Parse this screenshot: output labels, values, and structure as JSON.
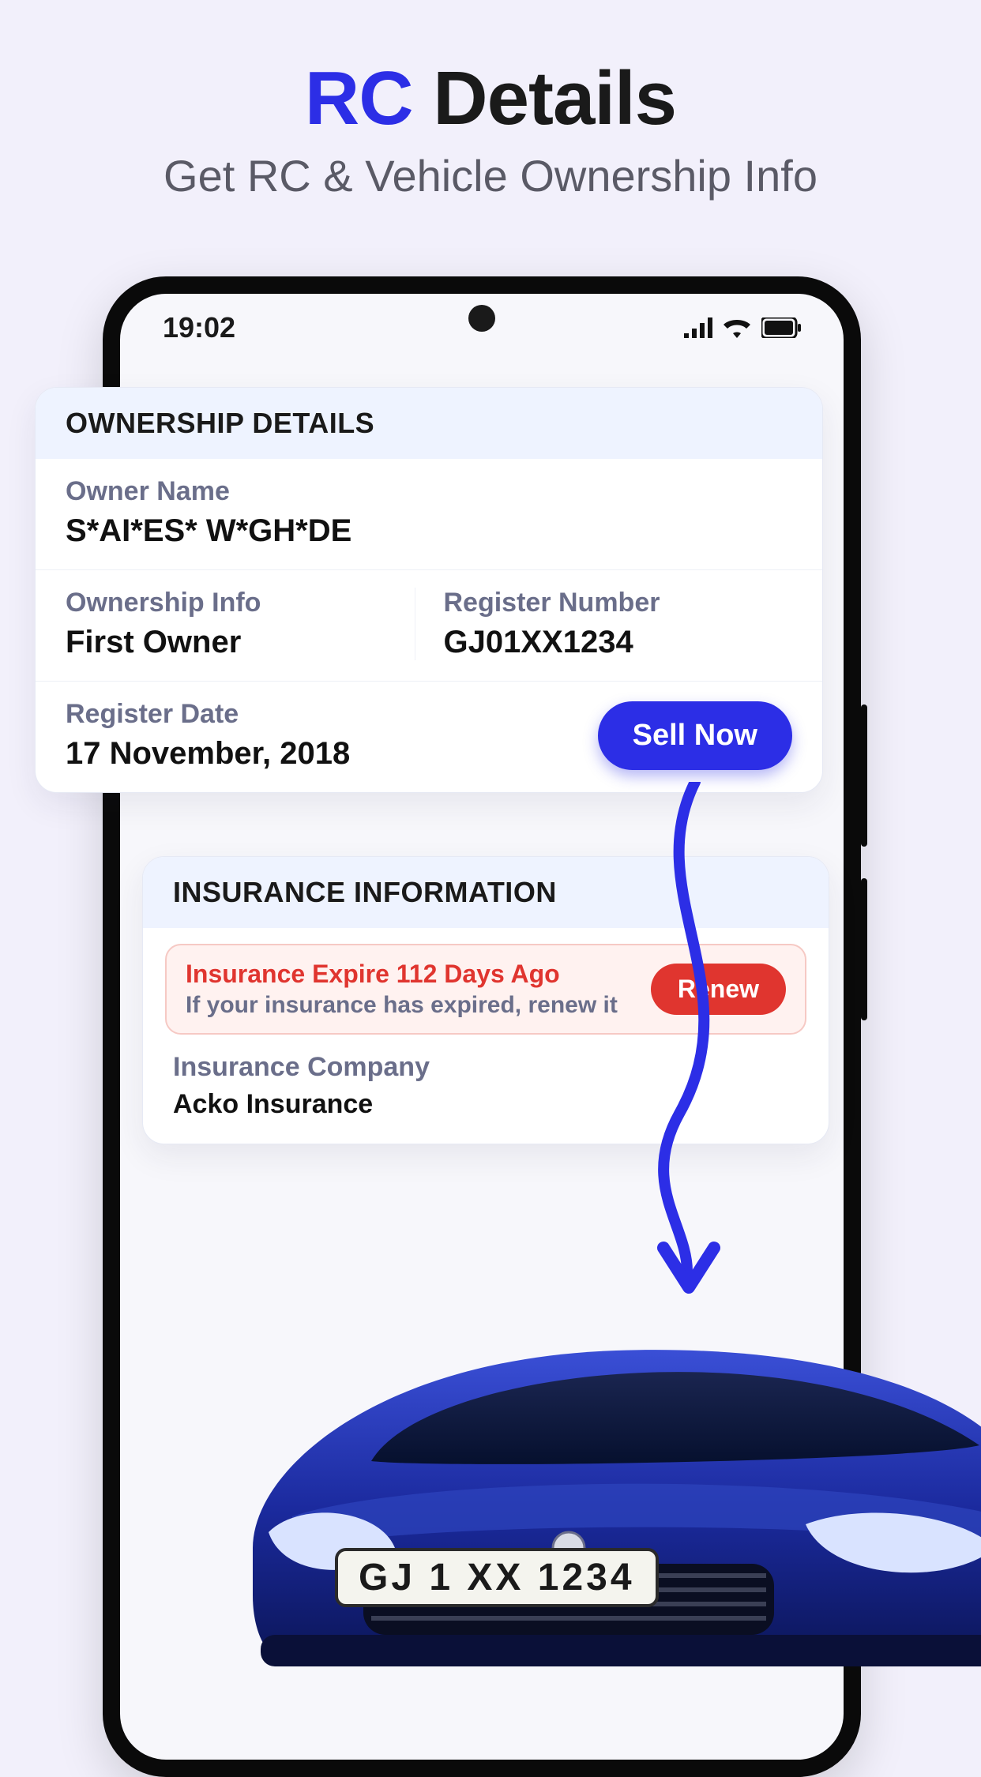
{
  "hero": {
    "title_accent": "RC",
    "title_rest": " Details",
    "subtitle": "Get RC & Vehicle Ownership Info"
  },
  "status": {
    "time": "19:02"
  },
  "ownership": {
    "header": "OWNERSHIP DETAILS",
    "owner_name_label": "Owner Name",
    "owner_name_value": "S*AI*ES* W*GH*DE",
    "ownership_info_label": "Ownership Info",
    "ownership_info_value": "First Owner",
    "register_number_label": "Register Number",
    "register_number_value": "GJ01XX1234",
    "register_date_label": "Register Date",
    "register_date_value": "17 November, 2018",
    "sell_label": "Sell Now"
  },
  "insurance": {
    "header": "INSURANCE INFORMATION",
    "alert_title": "Insurance Expire 112 Days Ago",
    "alert_sub": "If your insurance has expired, renew it",
    "renew_label": "Renew",
    "company_label": "Insurance Company",
    "company_value": "Acko Insurance"
  },
  "car": {
    "plate": "GJ 1 XX 1234"
  }
}
